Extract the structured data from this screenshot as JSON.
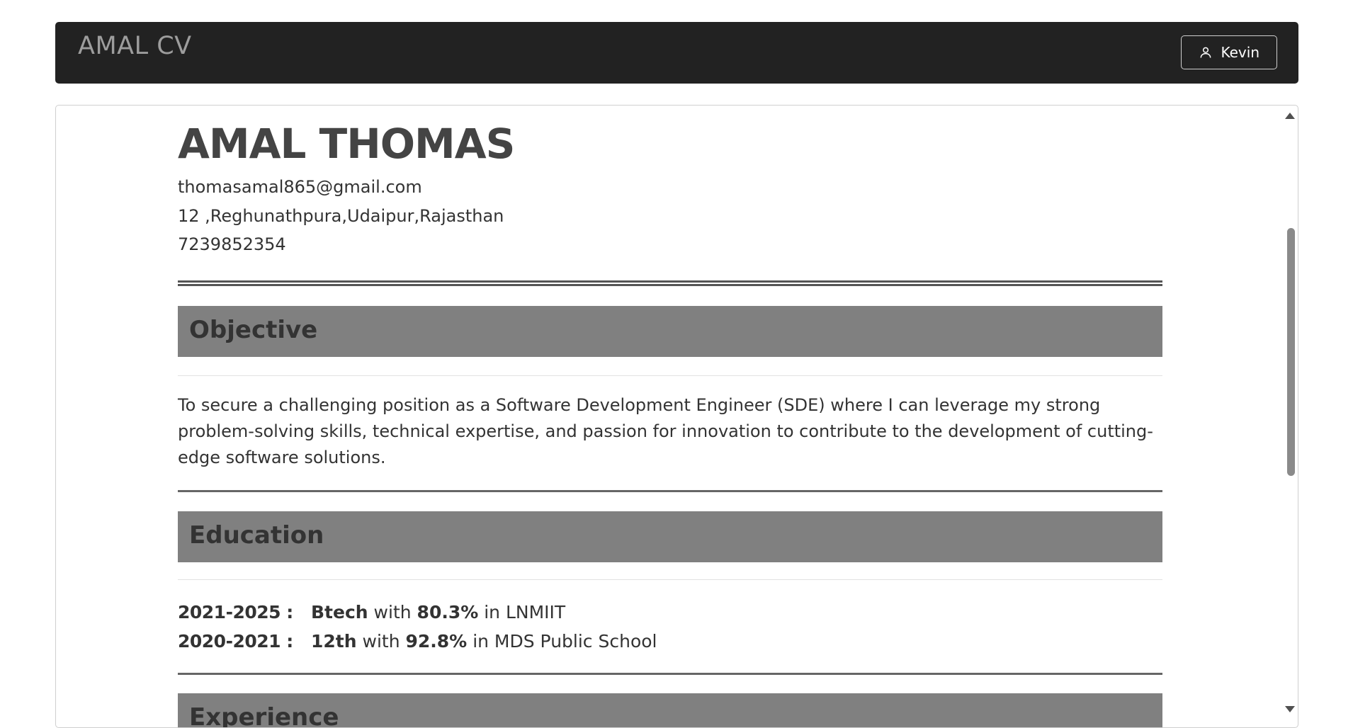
{
  "navbar": {
    "brand": "AMAL CV",
    "user_button_label": "Kevin"
  },
  "cv": {
    "name": "AMAL THOMAS",
    "email": "thomasamal865@gmail.com",
    "address": "12 ,Reghunathpura,Udaipur,Rajasthan",
    "phone": "7239852354",
    "objective": {
      "heading": "Objective",
      "text": "To secure a challenging position as a Software Development Engineer (SDE) where I can leverage my strong problem-solving skills, technical expertise, and passion for innovation to contribute to the development of cutting-edge software solutions."
    },
    "education": {
      "heading": "Education",
      "entries": [
        {
          "years": "2021-2025 :",
          "degree": "Btech",
          "with": "with",
          "score": "80.3%",
          "in": "in LNMIIT"
        },
        {
          "years": "2020-2021 :",
          "degree": "12th",
          "with": "with",
          "score": "92.8%",
          "in": "in MDS Public School"
        }
      ]
    },
    "experience": {
      "heading": "Experience"
    }
  },
  "icons": {
    "user": "user-icon",
    "scroll_up": "scroll-up-arrow",
    "scroll_down": "scroll-down-arrow"
  }
}
